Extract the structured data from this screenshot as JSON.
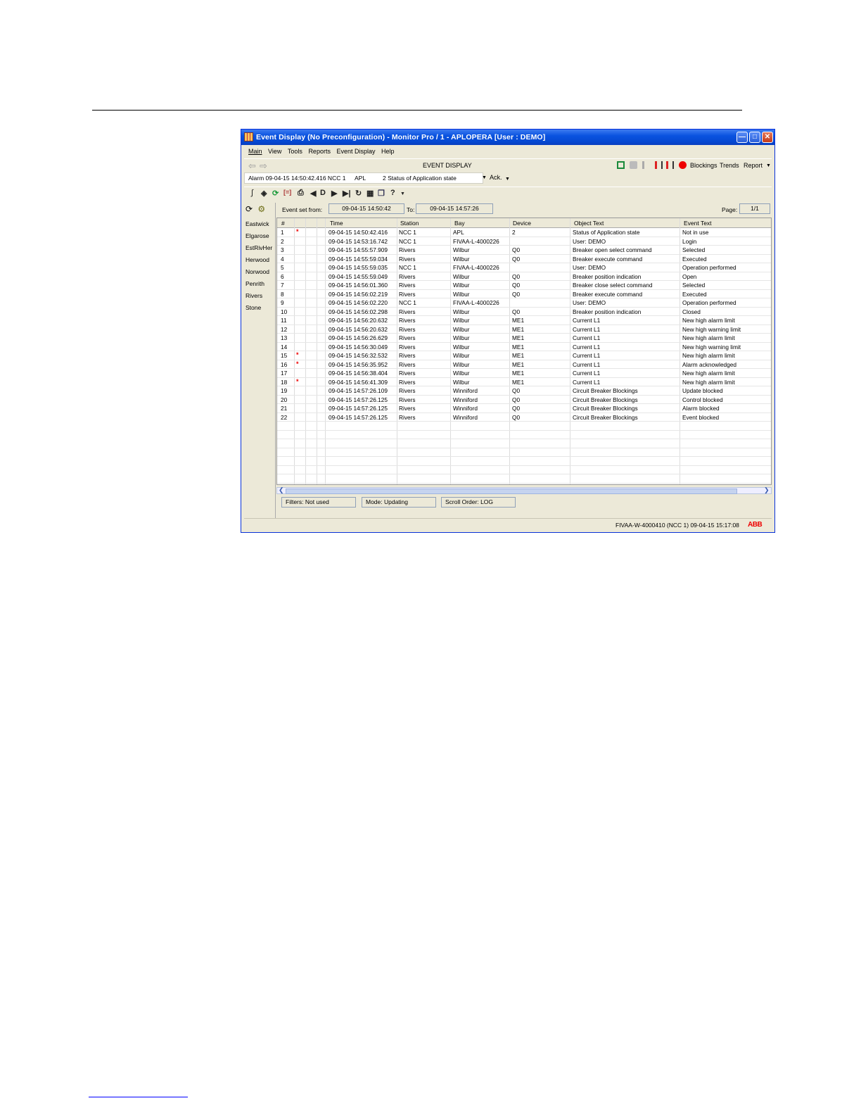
{
  "window": {
    "title": "Event Display (No Preconfiguration) - Monitor Pro / 1 - APLOPERA [User : DEMO]"
  },
  "menu": [
    "Main",
    "View",
    "Tools",
    "Reports",
    "Event Display",
    "Help"
  ],
  "toolbar": {
    "center_title": "EVENT DISPLAY",
    "blockings": "Blockings",
    "trends": "Trends",
    "report": "Report"
  },
  "alarm_line": {
    "alarm": "Alarm 09-04-15 14:50:42.416 NCC 1",
    "object": "APL",
    "text": "2 Status of Application state",
    "ack": "Ack."
  },
  "stations": [
    "Eastwick",
    "Elgarose",
    "EstRivHer",
    "Herwood",
    "Norwood",
    "Penrith",
    "Rivers",
    "Stone"
  ],
  "filter": {
    "from_label": "Event set from:",
    "from_value": "09-04-15 14:50:42",
    "to_label": "To:",
    "to_value": "09-04-15 14:57:26",
    "page_label": "Page:",
    "page_value": "1/1"
  },
  "columns": [
    "#",
    "Time",
    "Station",
    "Bay",
    "Device",
    "Object Text",
    "Event Text"
  ],
  "events": [
    {
      "n": "1",
      "mark": "*",
      "time": "09-04-15 14:50:42.416",
      "station": "NCC 1",
      "bay": "APL",
      "device": "2",
      "object": "Status of Application state",
      "event": "Not in use"
    },
    {
      "n": "2",
      "mark": "",
      "time": "09-04-15 14:53:16.742",
      "station": "NCC 1",
      "bay": "FIVAA-L-4000226",
      "device": "",
      "object": "User: DEMO",
      "event": "Login"
    },
    {
      "n": "3",
      "mark": "",
      "time": "09-04-15 14:55:57.909",
      "station": "Rivers",
      "bay": "Wilbur",
      "device": "Q0",
      "object": "Breaker open select command",
      "event": "Selected"
    },
    {
      "n": "4",
      "mark": "",
      "time": "09-04-15 14:55:59.034",
      "station": "Rivers",
      "bay": "Wilbur",
      "device": "Q0",
      "object": "Breaker execute command",
      "event": "Executed"
    },
    {
      "n": "5",
      "mark": "",
      "time": "09-04-15 14:55:59.035",
      "station": "NCC 1",
      "bay": "FIVAA-L-4000226",
      "device": "",
      "object": "User: DEMO",
      "event": "Operation performed"
    },
    {
      "n": "6",
      "mark": "",
      "time": "09-04-15 14:55:59.049",
      "station": "Rivers",
      "bay": "Wilbur",
      "device": "Q0",
      "object": "Breaker position indication",
      "event": "Open"
    },
    {
      "n": "7",
      "mark": "",
      "time": "09-04-15 14:56:01.360",
      "station": "Rivers",
      "bay": "Wilbur",
      "device": "Q0",
      "object": "Breaker close select command",
      "event": "Selected"
    },
    {
      "n": "8",
      "mark": "",
      "time": "09-04-15 14:56:02.219",
      "station": "Rivers",
      "bay": "Wilbur",
      "device": "Q0",
      "object": "Breaker execute command",
      "event": "Executed"
    },
    {
      "n": "9",
      "mark": "",
      "time": "09-04-15 14:56:02.220",
      "station": "NCC 1",
      "bay": "FIVAA-L-4000226",
      "device": "",
      "object": "User: DEMO",
      "event": "Operation performed"
    },
    {
      "n": "10",
      "mark": "",
      "time": "09-04-15 14:56:02.298",
      "station": "Rivers",
      "bay": "Wilbur",
      "device": "Q0",
      "object": "Breaker position indication",
      "event": "Closed"
    },
    {
      "n": "11",
      "mark": "",
      "time": "09-04-15 14:56:20.632",
      "station": "Rivers",
      "bay": "Wilbur",
      "device": "ME1",
      "object": "Current L1",
      "event": "New high alarm limit"
    },
    {
      "n": "12",
      "mark": "",
      "time": "09-04-15 14:56:20.632",
      "station": "Rivers",
      "bay": "Wilbur",
      "device": "ME1",
      "object": "Current L1",
      "event": "New high warning limit"
    },
    {
      "n": "13",
      "mark": "",
      "time": "09-04-15 14:56:26.629",
      "station": "Rivers",
      "bay": "Wilbur",
      "device": "ME1",
      "object": "Current L1",
      "event": "New high alarm limit"
    },
    {
      "n": "14",
      "mark": "",
      "time": "09-04-15 14:56:30.049",
      "station": "Rivers",
      "bay": "Wilbur",
      "device": "ME1",
      "object": "Current L1",
      "event": "New high warning limit"
    },
    {
      "n": "15",
      "mark": "*",
      "time": "09-04-15 14:56:32.532",
      "station": "Rivers",
      "bay": "Wilbur",
      "device": "ME1",
      "object": "Current L1",
      "event": "New high alarm limit"
    },
    {
      "n": "16",
      "mark": "*",
      "time": "09-04-15 14:56:35.952",
      "station": "Rivers",
      "bay": "Wilbur",
      "device": "ME1",
      "object": "Current L1",
      "event": "Alarm acknowledged"
    },
    {
      "n": "17",
      "mark": "",
      "time": "09-04-15 14:56:38.404",
      "station": "Rivers",
      "bay": "Wilbur",
      "device": "ME1",
      "object": "Current L1",
      "event": "New high alarm limit"
    },
    {
      "n": "18",
      "mark": "*",
      "time": "09-04-15 14:56:41.309",
      "station": "Rivers",
      "bay": "Wilbur",
      "device": "ME1",
      "object": "Current L1",
      "event": "New high alarm limit"
    },
    {
      "n": "19",
      "mark": "",
      "time": "09-04-15 14:57:26.109",
      "station": "Rivers",
      "bay": "Winniford",
      "device": "Q0",
      "object": "Circuit Breaker Blockings",
      "event": "Update blocked"
    },
    {
      "n": "20",
      "mark": "",
      "time": "09-04-15 14:57:26.125",
      "station": "Rivers",
      "bay": "Winniford",
      "device": "Q0",
      "object": "Circuit Breaker Blockings",
      "event": "Control blocked"
    },
    {
      "n": "21",
      "mark": "",
      "time": "09-04-15 14:57:26.125",
      "station": "Rivers",
      "bay": "Winniford",
      "device": "Q0",
      "object": "Circuit Breaker Blockings",
      "event": "Alarm blocked"
    },
    {
      "n": "22",
      "mark": "",
      "time": "09-04-15 14:57:26.125",
      "station": "Rivers",
      "bay": "Winniford",
      "device": "Q0",
      "object": "Circuit Breaker Blockings",
      "event": "Event blocked"
    }
  ],
  "status": {
    "filters": "Filters: Not used",
    "mode": "Mode: Updating",
    "scroll": "Scroll Order: LOG"
  },
  "footer": {
    "info": "FIVAA-W-4000410 (NCC 1)   09-04-15 15:17:08",
    "logo": "ABB"
  },
  "colors": {
    "titlebar": "#0a53e0",
    "alarm_mark": "#ee0000",
    "window_bg": "#ece9d8"
  }
}
